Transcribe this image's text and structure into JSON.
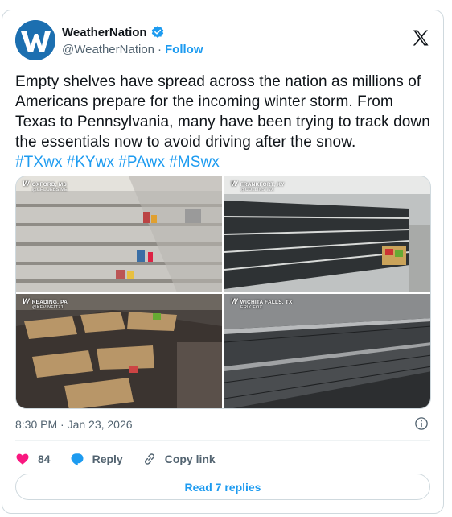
{
  "author": {
    "display_name": "WeatherNation",
    "handle": "@WeatherNation",
    "separator": "·",
    "follow_label": "Follow"
  },
  "tweet": {
    "text": "Empty shelves have spread across the nation as millions of Americans prepare for the incoming winter storm. From Texas to Pennsylvania, many have been trying to track down the essentials now to avoid driving after the snow.",
    "hashtags": [
      "#TXwx",
      "#KYwx",
      "#PAwx",
      "#MSwx"
    ],
    "timestamp": "8:30 PM · Jan 23, 2026"
  },
  "media": [
    {
      "location": "OXFORD, MS",
      "credit": "@CHLOEBSIME"
    },
    {
      "location": "FRANKFORT, KY",
      "credit": "@COLLINS WX"
    },
    {
      "location": "READING, PA",
      "credit": "@KEVINFITZ1"
    },
    {
      "location": "WICHITA FALLS, TX",
      "credit": "ERIK FOX"
    }
  ],
  "watermark": "W",
  "actions": {
    "like_count": "84",
    "reply_label": "Reply",
    "copy_label": "Copy link"
  },
  "replies_button": "Read 7 replies",
  "colors": {
    "accent": "#1d9bf0",
    "like": "#f91880",
    "text_secondary": "#536471",
    "border": "#cfd9de"
  },
  "icons": [
    "verified-badge-icon",
    "x-logo-icon",
    "info-icon",
    "heart-icon",
    "reply-icon",
    "link-icon"
  ]
}
